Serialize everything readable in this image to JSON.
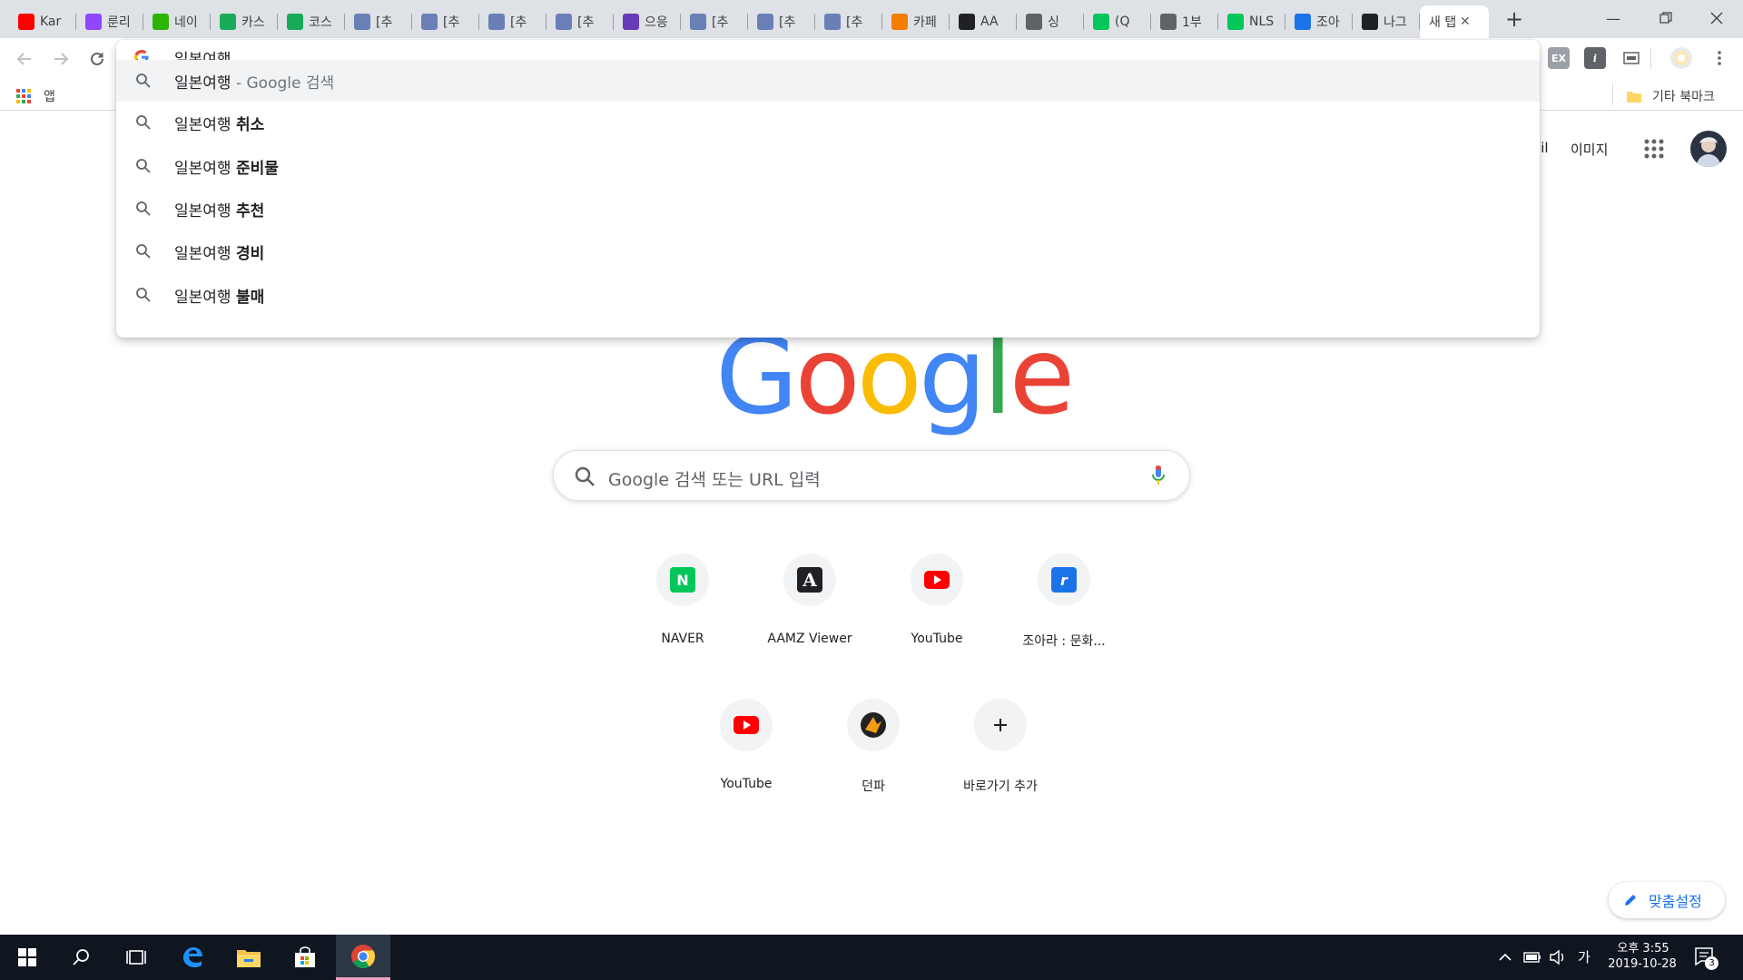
{
  "tabs": [
    {
      "title": "Kar",
      "fav_color": "#ff0000",
      "icon": "youtube-icon"
    },
    {
      "title": "룬리",
      "fav_color": "#9146ff",
      "icon": "twitch-icon"
    },
    {
      "title": "네이",
      "fav_color": "#2db400",
      "icon": "naver-cafe-icon"
    },
    {
      "title": "카스",
      "fav_color": "#1aab5a",
      "icon": "site-icon"
    },
    {
      "title": "코스",
      "fav_color": "#1aab5a",
      "icon": "site-icon"
    },
    {
      "title": "[추",
      "fav_color": "#6a7fb5",
      "icon": "site-icon"
    },
    {
      "title": "[추",
      "fav_color": "#6a7fb5",
      "icon": "site-icon"
    },
    {
      "title": "[추",
      "fav_color": "#6a7fb5",
      "icon": "site-icon"
    },
    {
      "title": "[추",
      "fav_color": "#6a7fb5",
      "icon": "site-icon"
    },
    {
      "title": "으응",
      "fav_color": "#673ab7",
      "icon": "list-icon"
    },
    {
      "title": "[추",
      "fav_color": "#6a7fb5",
      "icon": "site-icon"
    },
    {
      "title": "[추",
      "fav_color": "#6a7fb5",
      "icon": "site-icon"
    },
    {
      "title": "[추",
      "fav_color": "#6a7fb5",
      "icon": "site-icon"
    },
    {
      "title": "카페",
      "fav_color": "#f57d00",
      "icon": "blogger-icon"
    },
    {
      "title": "AA",
      "fav_color": "#202124",
      "icon": "aamz-icon"
    },
    {
      "title": "싱",
      "fav_color": "#5f6368",
      "icon": "site-icon"
    },
    {
      "title": "(Q",
      "fav_color": "#03c75a",
      "icon": "blog-icon"
    },
    {
      "title": "1부",
      "fav_color": "#5f6368",
      "icon": "globe-icon"
    },
    {
      "title": "NLS",
      "fav_color": "#03c75a",
      "icon": "blog-icon"
    },
    {
      "title": "조아",
      "fav_color": "#1a73e8",
      "icon": "joara-icon"
    },
    {
      "title": "나그",
      "fav_color": "#202124",
      "icon": "aamz-icon"
    },
    {
      "title": "새 탭",
      "fav_color": "",
      "icon": ""
    }
  ],
  "toolbar": {
    "omnibox_text": "일본여행"
  },
  "bookmarks": {
    "apps_label": "앱",
    "other_label": "기타 북마크"
  },
  "suggestions": [
    {
      "query": "일본여행",
      "bold": "",
      "suffix": " - Google 검색"
    },
    {
      "query": "일본여행 ",
      "bold": "취소",
      "suffix": ""
    },
    {
      "query": "일본여행 ",
      "bold": "준비물",
      "suffix": ""
    },
    {
      "query": "일본여행 ",
      "bold": "추천",
      "suffix": ""
    },
    {
      "query": "일본여행 ",
      "bold": "경비",
      "suffix": ""
    },
    {
      "query": "일본여행 ",
      "bold": "불매",
      "suffix": ""
    }
  ],
  "header_links": {
    "gmail": "ail",
    "images": "이미지"
  },
  "search": {
    "placeholder": "Google 검색 또는 URL 입력"
  },
  "shortcuts": [
    {
      "label": "NAVER",
      "icon": "naver-icon",
      "color": "#03c75a"
    },
    {
      "label": "AAMZ Viewer",
      "icon": "aamz-icon",
      "color": "#202124"
    },
    {
      "label": "YouTube",
      "icon": "youtube-icon",
      "color": "#ff0000"
    },
    {
      "label": "조아라 : 문화...",
      "icon": "joara-icon",
      "color": "#1a73e8"
    },
    {
      "label": "YouTube",
      "icon": "youtube-icon",
      "color": "#ff0000"
    },
    {
      "label": "던파",
      "icon": "dnf-icon",
      "color": "#222222"
    },
    {
      "label": "바로가기 추가",
      "icon": "add-icon",
      "color": "#5f6368"
    }
  ],
  "customize_label": "맞춤설정",
  "taskbar": {
    "time": "오후 3:55",
    "date": "2019-10-28",
    "ime": "가",
    "notif_count": "3"
  }
}
